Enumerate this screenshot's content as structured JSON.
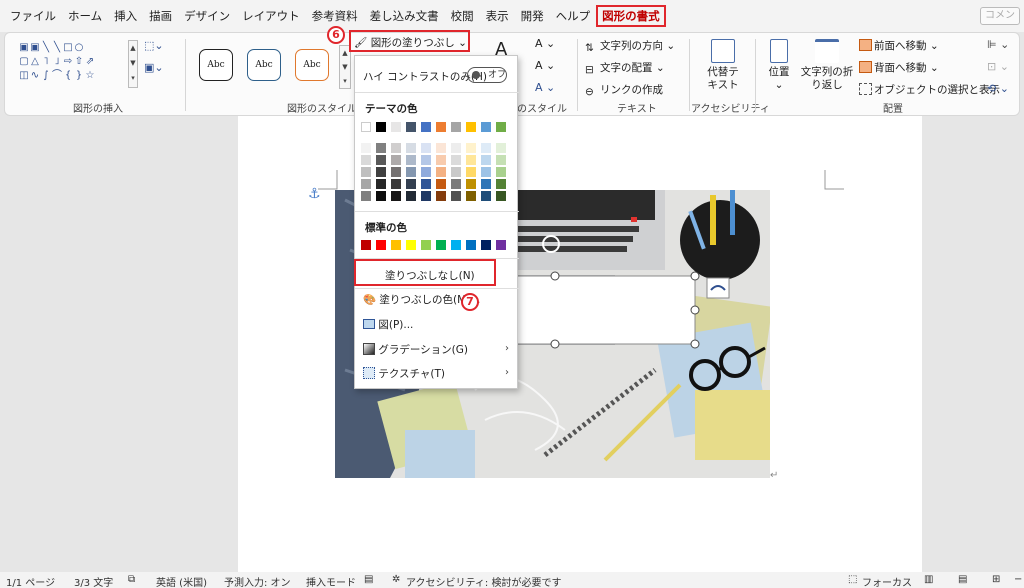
{
  "menubar": {
    "tabs": [
      "ファイル",
      "ホーム",
      "挿入",
      "描画",
      "デザイン",
      "レイアウト",
      "参考資料",
      "差し込み文書",
      "校閲",
      "表示",
      "開発",
      "ヘルプ",
      "図形の書式"
    ],
    "active_index": 12,
    "comment_label": "コメン"
  },
  "ribbon": {
    "insert_shapes_label": "図形の挿入",
    "shape_styles_label": "図形のスタイル",
    "style_samples": [
      "Abc",
      "Abc",
      "Abc"
    ],
    "wordart_styles_label": "のスタイル",
    "text_group": {
      "direction": "文字列の方向",
      "align": "文字の配置",
      "link": "リンクの作成",
      "label": "テキスト"
    },
    "accessibility_group": {
      "alt_text": "代替テ\nキスト",
      "label": "アクセシビリティ"
    },
    "arrange_group": {
      "position": "位置",
      "wrap": "文字列の折\nり返し",
      "bring_forward": "前面へ移動",
      "send_backward": "背面へ移動",
      "selection_pane": "オブジェクトの選択と表示",
      "label": "配置"
    }
  },
  "dropdown": {
    "fill_button_label": "図形の塗りつぶし",
    "high_contrast_label": "ハイ コントラストのみ(H)",
    "toggle_label": "オフ",
    "theme_colors_title": "テーマの色",
    "standard_colors_title": "標準の色",
    "no_fill": "塗りつぶしなし(N)",
    "more_colors": "塗りつぶしの色(M)...",
    "picture": "図(P)...",
    "gradient": "グラデーション(G)",
    "texture": "テクスチャ(T)",
    "theme_top_row": [
      "#ffffff",
      "#000000",
      "#e7e6e6",
      "#44546a",
      "#4472c4",
      "#ed7d31",
      "#a5a5a5",
      "#ffc000",
      "#5b9bd5",
      "#70ad47"
    ],
    "theme_columns": [
      [
        "#f2f2f2",
        "#d9d9d9",
        "#bfbfbf",
        "#a6a6a6",
        "#808080"
      ],
      [
        "#808080",
        "#595959",
        "#404040",
        "#262626",
        "#0d0d0d"
      ],
      [
        "#d0cece",
        "#aeaaaa",
        "#757171",
        "#3a3838",
        "#171616"
      ],
      [
        "#d6dce4",
        "#adb9ca",
        "#8497b0",
        "#333f50",
        "#222a35"
      ],
      [
        "#d9e2f3",
        "#b4c7e7",
        "#8faadc",
        "#2f5597",
        "#1f3864"
      ],
      [
        "#fbe5d6",
        "#f8cbad",
        "#f4b183",
        "#c55a11",
        "#843c0c"
      ],
      [
        "#ededed",
        "#dbdbdb",
        "#c9c9c9",
        "#7b7b7b",
        "#525252"
      ],
      [
        "#fff2cc",
        "#ffe699",
        "#ffd966",
        "#bf9000",
        "#7f6000"
      ],
      [
        "#deebf7",
        "#bdd7ee",
        "#9dc3e6",
        "#2e75b6",
        "#1f4e79"
      ],
      [
        "#e2f0d9",
        "#c5e0b4",
        "#a9d18e",
        "#548235",
        "#385723"
      ]
    ],
    "standard_colors": [
      "#c00000",
      "#ff0000",
      "#ffc000",
      "#ffff00",
      "#92d050",
      "#00b050",
      "#00b0f0",
      "#0070c0",
      "#002060",
      "#7030a0"
    ]
  },
  "annotations": {
    "step6": "6",
    "step7": "7"
  },
  "statusbar": {
    "page": "1/1 ページ",
    "words": "3/3 文字",
    "language": "英語 (米国)",
    "predictive": "予測入力: オン",
    "insert_mode": "挿入モード",
    "accessibility": "アクセシビリティ: 検討が必要です",
    "focus": "フォーカス"
  }
}
